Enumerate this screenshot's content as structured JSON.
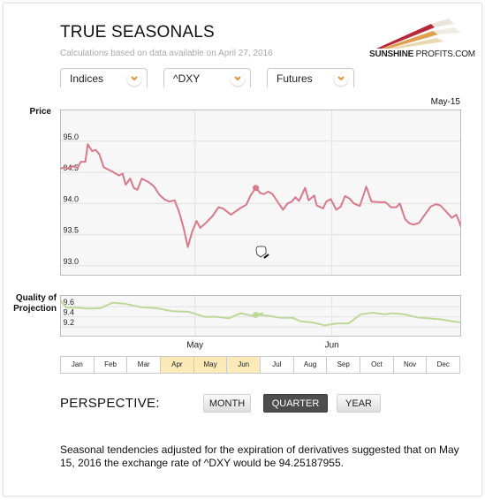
{
  "header": {
    "title": "TRUE SEASONALS",
    "subtitle": "Calculations based on data available on April 27, 2016",
    "logo_bold": "SUNSHINE",
    "logo_rest": " PROFITS.COM"
  },
  "selectors": [
    {
      "label": "Indices",
      "icon": "chevron-down-icon"
    },
    {
      "label": "^DXY",
      "icon": "chevron-down-icon"
    },
    {
      "label": "Futures",
      "icon": "chevron-down-icon"
    }
  ],
  "colors": {
    "price_line": "#d9798a",
    "quality_line": "#bcd89a",
    "selected_month": "#fbe9b7",
    "active_button": "#4d4d4d"
  },
  "chart_data": [
    {
      "type": "line",
      "title": "Price",
      "ylabel": "Price",
      "highlight_label": "May-15",
      "ylim": [
        92.85,
        95.5
      ],
      "yticks": [
        95.0,
        94.5,
        94.0,
        93.5,
        93.0
      ],
      "ytick_labels": [
        "95.0",
        "94.5",
        "94.0",
        "93.5",
        "93.0"
      ],
      "xlim": [
        0,
        100
      ],
      "xgrid": [
        33.6,
        67.8
      ],
      "grid": true,
      "highlight_index": 40,
      "series": [
        {
          "name": "^DXY seasonal price",
          "x": [
            0,
            1.3,
            2.2,
            3.1,
            4.2,
            5.1,
            6.2,
            6.8,
            7.9,
            8.8,
            9.7,
            10.8,
            13.0,
            14.6,
            15.5,
            16.3,
            17.4,
            18.3,
            19.2,
            20.3,
            22.1,
            23.4,
            24.7,
            26.1,
            27.2,
            28.5,
            29.6,
            30.7,
            31.8,
            32.9,
            34.0,
            34.9,
            36.2,
            38.0,
            39.5,
            40.6,
            42.6,
            44.8,
            46.4,
            47.5,
            48.8,
            49.9,
            50.8,
            51.9,
            53.0,
            54.3,
            55.6,
            56.7,
            57.8,
            58.7,
            59.6,
            61.1,
            62.0,
            63.4,
            64.0,
            65.6,
            66.4,
            67.5,
            68.9,
            70.0,
            71.1,
            72.2,
            73.3,
            74.8,
            76.4,
            77.7,
            79.9,
            81.2,
            82.6,
            83.9,
            84.8,
            86.1,
            87.2,
            88.3,
            89.6,
            90.9,
            92.5,
            93.8,
            94.9,
            96.2,
            97.8,
            98.9,
            99.8,
            100
          ],
          "y": [
            94.56,
            94.58,
            94.55,
            94.6,
            94.57,
            94.67,
            94.67,
            94.95,
            94.84,
            94.86,
            94.79,
            94.58,
            94.51,
            94.45,
            94.48,
            94.3,
            94.4,
            94.25,
            94.22,
            94.4,
            94.34,
            94.27,
            94.14,
            94.06,
            94.03,
            94.05,
            93.87,
            93.62,
            93.3,
            93.55,
            93.72,
            93.61,
            93.68,
            93.8,
            93.94,
            93.92,
            93.82,
            93.92,
            93.98,
            94.13,
            94.25,
            94.17,
            94.15,
            94.19,
            94.15,
            94.02,
            93.9,
            94.0,
            94.03,
            94.1,
            94.04,
            94.25,
            94.05,
            94.13,
            93.97,
            93.92,
            94.03,
            94.07,
            93.9,
            93.95,
            94.12,
            94.08,
            94.0,
            93.96,
            94.27,
            94.03,
            94.02,
            94.02,
            93.94,
            93.94,
            94.0,
            93.75,
            93.68,
            93.66,
            93.69,
            93.81,
            93.95,
            93.99,
            93.97,
            93.88,
            93.77,
            93.82,
            93.68,
            93.63
          ]
        }
      ]
    },
    {
      "type": "line",
      "title": "Quality of Projection",
      "ylabel": "Quality of Projection",
      "ylim": [
        9.02,
        9.82
      ],
      "yticks": [
        9.6,
        9.4,
        9.2
      ],
      "ytick_labels": [
        "9.6",
        "9.4",
        "9.2"
      ],
      "xlim": [
        0,
        100
      ],
      "xgrid": [
        33.6,
        67.8
      ],
      "xtick_labels": [
        {
          "label": "May",
          "x": 33.6
        },
        {
          "label": "Jun",
          "x": 67.8
        }
      ],
      "grid": true,
      "highlight_index": 17,
      "series": [
        {
          "name": "Quality",
          "x": [
            0,
            1.5,
            4.0,
            7.0,
            10.0,
            13.0,
            16.0,
            20.0,
            24.0,
            28.0,
            32.0,
            36.0,
            39.0,
            42.0,
            45.0,
            48.0,
            50.5,
            48.8,
            52.0,
            55.0,
            58.0,
            60.0,
            63.0,
            66.0,
            69.0,
            72.0,
            75.0,
            78.0,
            81.0,
            83.0,
            86.0,
            89.0,
            92.0,
            95.0,
            98.0,
            100
          ],
          "y": [
            9.72,
            9.58,
            9.58,
            9.56,
            9.57,
            9.68,
            9.66,
            9.59,
            9.57,
            9.51,
            9.5,
            9.4,
            9.4,
            9.37,
            9.47,
            9.42,
            9.47,
            9.44,
            9.42,
            9.38,
            9.38,
            9.31,
            9.29,
            9.23,
            9.27,
            9.27,
            9.45,
            9.48,
            9.45,
            9.47,
            9.45,
            9.39,
            9.37,
            9.35,
            9.31,
            9.29
          ]
        }
      ]
    }
  ],
  "months": [
    {
      "label": "Jan",
      "selected": false
    },
    {
      "label": "Feb",
      "selected": false
    },
    {
      "label": "Mar",
      "selected": false
    },
    {
      "label": "Apr",
      "selected": true
    },
    {
      "label": "May",
      "selected": true
    },
    {
      "label": "Jun",
      "selected": true
    },
    {
      "label": "Jul",
      "selected": false
    },
    {
      "label": "Aug",
      "selected": false
    },
    {
      "label": "Sep",
      "selected": false
    },
    {
      "label": "Oct",
      "selected": false
    },
    {
      "label": "Nov",
      "selected": false
    },
    {
      "label": "Dec",
      "selected": false
    }
  ],
  "perspective": {
    "label": "PERSPECTIVE:",
    "buttons": [
      {
        "label": "MONTH",
        "active": false
      },
      {
        "label": "QUARTER",
        "active": true
      },
      {
        "label": "YEAR",
        "active": false
      }
    ]
  },
  "description": "Seasonal tendencies adjusted for the expiration of derivatives suggested that on May 15, 2016 the exchange rate of ^DXY would be 94.25187955."
}
